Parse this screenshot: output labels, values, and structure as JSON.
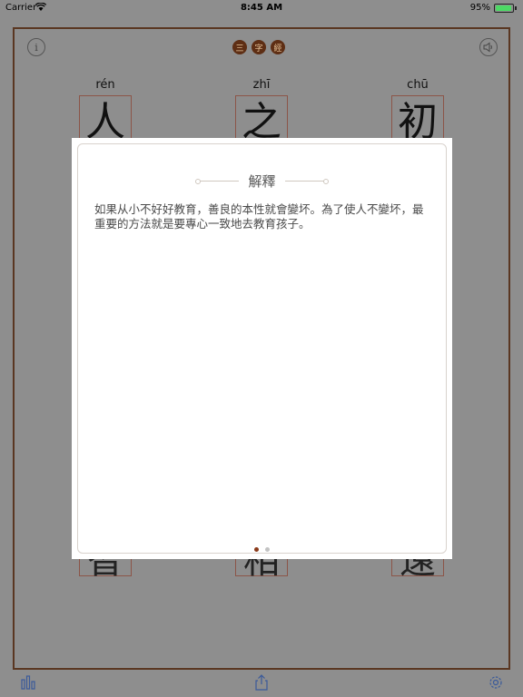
{
  "status_bar": {
    "carrier": "Carrier",
    "time": "8:45 AM",
    "battery_percent": "95%",
    "battery_level": 0.95
  },
  "header": {
    "info_icon": "info-icon",
    "title_seals": [
      "三",
      "字",
      "經"
    ],
    "speaker_icon": "speaker-icon"
  },
  "characters": {
    "top": [
      {
        "pinyin": "rén",
        "char": "人"
      },
      {
        "pinyin": "zhī",
        "char": "之"
      },
      {
        "pinyin": "chū",
        "char": "初"
      }
    ],
    "bottom": [
      {
        "char": "智"
      },
      {
        "char": "相"
      },
      {
        "char": "遠"
      }
    ]
  },
  "modal": {
    "title": "解釋",
    "body": "如果从小不好好教育，善良的本性就會變坏。為了使人不變坏，最重要的方法就是要專心一致地去教育孩子。",
    "pages": 2,
    "active_page": 1
  },
  "toolbar": {
    "stats_icon": "bar-chart-icon",
    "share_icon": "share-icon",
    "settings_icon": "gear-icon"
  },
  "colors": {
    "frame_border": "#5a3722",
    "grid_line": "#8c5548",
    "seal": "#5e2e14",
    "active_dot": "#8a3a1a"
  }
}
